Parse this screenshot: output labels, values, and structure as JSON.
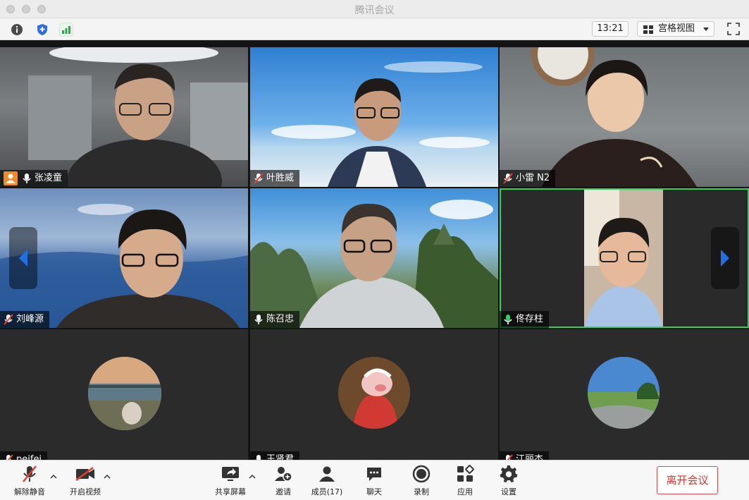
{
  "window": {
    "title": "腾讯会议"
  },
  "status": {
    "clock": "13:21",
    "view_label": "宫格视图"
  },
  "participants": [
    {
      "name": "张凌童",
      "mic": "on",
      "host": true
    },
    {
      "name": "叶胜威",
      "mic": "muted"
    },
    {
      "name": "小雷 N2",
      "mic": "muted"
    },
    {
      "name": "刘峰源",
      "mic": "muted"
    },
    {
      "name": "陈召忠",
      "mic": "on"
    },
    {
      "name": "佟存柱",
      "mic": "speaking",
      "active": true
    },
    {
      "name": "peifei",
      "mic": "muted",
      "video": "off"
    },
    {
      "name": "王贤君",
      "mic": "on",
      "video": "off"
    },
    {
      "name": "江丽杰",
      "mic": "muted",
      "video": "off"
    }
  ],
  "toolbar": {
    "unmute_label": "解除静音",
    "start_video_label": "开启视频",
    "share_label": "共享屏幕",
    "invite_label": "邀请",
    "members_label": "成员(17)",
    "chat_label": "聊天",
    "record_label": "录制",
    "apps_label": "应用",
    "settings_label": "设置",
    "leave_label": "离开会议"
  },
  "colors": {
    "active_speaker": "#2fd25b",
    "leave": "#e0362f",
    "nav_arrow": "#1f6fe5"
  }
}
